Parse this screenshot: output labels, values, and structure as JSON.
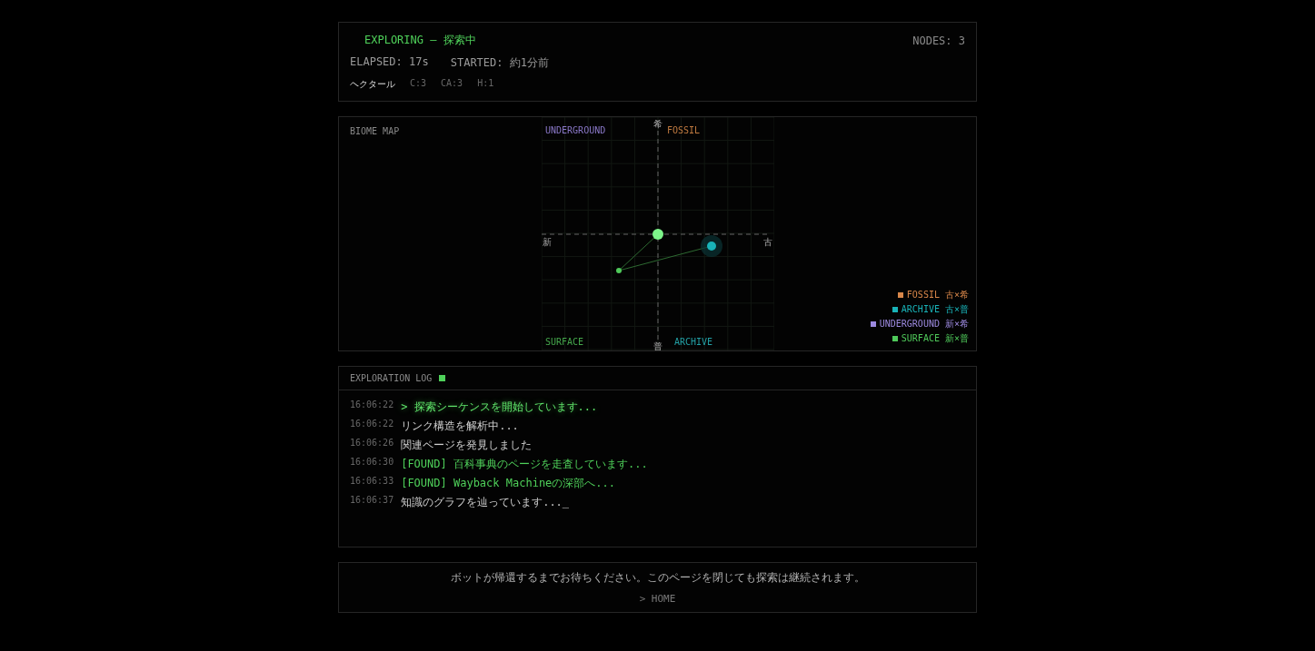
{
  "status": {
    "title": "EXPLORING — 探索中",
    "nodes": "NODES: 3",
    "elapsed": "ELAPSED: 17s",
    "started": "STARTED: 約1分前",
    "tags": [
      "ヘクタール",
      "C:3",
      "CA:3",
      "H:1"
    ]
  },
  "biome_map": {
    "title": "BIOME MAP",
    "quadrants": [
      {
        "label": "UNDERGROUND",
        "color": "#8a78c8"
      },
      {
        "label": "FOSSIL",
        "color": "#c07a40"
      },
      {
        "label": "SURFACE",
        "color": "#45a84c"
      },
      {
        "label": "ARCHIVE",
        "color": "#23a0a5"
      }
    ],
    "axes": {
      "top": "希",
      "bottom": "普",
      "left": "新",
      "right": "古"
    },
    "legend": [
      {
        "label": "FOSSIL 古×希",
        "color": "#d9874a"
      },
      {
        "label": "ARCHIVE 古×普",
        "color": "#19b3b8"
      },
      {
        "label": "UNDERGROUND 新×希",
        "color": "#9d8ae0"
      },
      {
        "label": "SURFACE 新×普",
        "color": "#4fc95a"
      }
    ]
  },
  "log": {
    "title": "EXPLORATION LOG",
    "entries": [
      {
        "time": "16:06:22",
        "text": "> 探索シーケンスを開始しています...",
        "kind": "start"
      },
      {
        "time": "16:06:22",
        "text": "リンク構造を解析中...",
        "kind": "info"
      },
      {
        "time": "16:06:26",
        "text": "関連ページを発見しました",
        "kind": "info"
      },
      {
        "time": "16:06:30",
        "text": "[FOUND] 百科事典のページを走査しています...",
        "kind": "found"
      },
      {
        "time": "16:06:33",
        "text": "[FOUND] Wayback Machineの深部へ...",
        "kind": "found"
      },
      {
        "time": "16:06:37",
        "text": "知識のグラフを辿っています..._",
        "kind": "info"
      }
    ]
  },
  "footer": {
    "message": "ボットが帰還するまでお待ちください。このページを閉じても探索は継続されます。",
    "link": "> HOME"
  }
}
